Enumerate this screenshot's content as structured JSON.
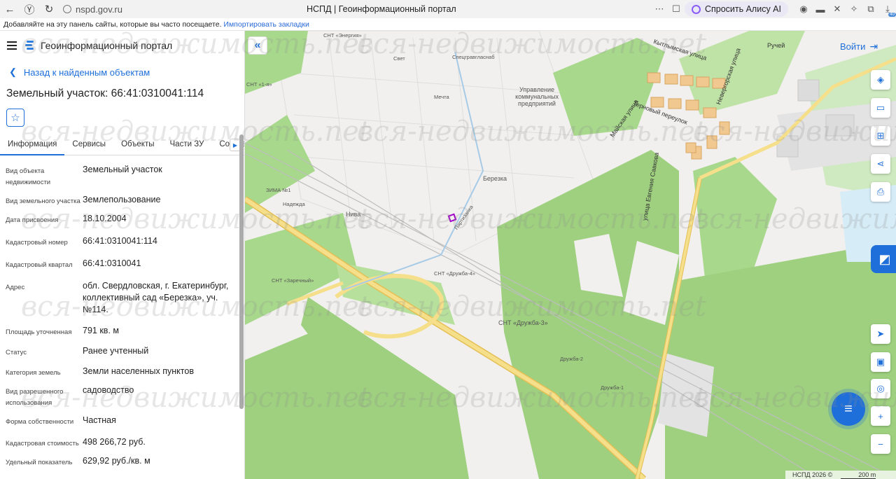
{
  "browser": {
    "url": "nspd.gov.ru",
    "tab_title": "НСПД | Геоинформационный портал",
    "alice_label": "Спросить Алису AI",
    "badge": "40",
    "bookmarks_text": "Добавляйте на эту панель сайты, которые вы часто посещаете.",
    "bookmarks_link": "Импортировать закладки"
  },
  "panel": {
    "portal_title": "Геоинформационный портал",
    "back_label": "Назад к найденным объектам",
    "object_title": "Земельный участок: 66:41:0310041:114",
    "tabs": [
      "Информация",
      "Сервисы",
      "Объекты",
      "Части ЗУ",
      "Состав"
    ],
    "properties": [
      {
        "key": "Вид объекта недвижимости",
        "value": "Земельный участок"
      },
      {
        "key": "Вид земельного участка",
        "value": "Землепользование"
      },
      {
        "key": "Дата присвоения",
        "value": "18.10.2004"
      },
      {
        "key": "Кадастровый номер",
        "value": "66:41:0310041:114"
      },
      {
        "key": "Кадастровый квартал",
        "value": "66:41:0310041"
      },
      {
        "key": "Адрес",
        "value": "обл. Свердловская, г. Екатеринбург, коллективный сад «Березка», уч. №114."
      },
      {
        "key": "Площадь уточненная",
        "value": "791 кв. м"
      },
      {
        "key": "Статус",
        "value": "Ранее учтенный"
      },
      {
        "key": "Категория земель",
        "value": "Земли населенных пунктов"
      },
      {
        "key": "Вид разрешенного использования",
        "value": "садоводство"
      },
      {
        "key": "Форма собственности",
        "value": "Частная"
      },
      {
        "key": "Кадастровая стоимость",
        "value": "498 266,72 руб."
      },
      {
        "key": "Удельный показатель",
        "value": "629,92 руб./кв. м"
      }
    ]
  },
  "map": {
    "login_label": "Войти",
    "labels": {
      "snt_energia": "СНТ «Энергия»",
      "svet": "Свет",
      "specgrav": "Спецгравгласнаб",
      "mechta": "Мечта",
      "upravlenie": "Управление коммунальных предприятий",
      "berezka": "Березка",
      "niva": "Нива",
      "nadezhda": "Надежда",
      "zima": "ЗИМА №1",
      "snt_zarechny": "СНТ «Заречный»",
      "snt_druzhba4": "СНТ «Дружба-4»",
      "snt_druzhba3": "СНТ «Дружба-3»",
      "druzhba2": "Дружба-2",
      "druzhba1": "Дружба-1",
      "savkova": "улица Евгения Савкова",
      "ternovy": "Терновый переулок",
      "maiskaya": "Майская улица",
      "kytlymskaya": "Кытлымская улица",
      "ruchei": "Ручей",
      "partizanka": "Партизанка",
      "snt1": "СНТ «1-я»",
      "nevergorskaya": "Невергорская улица"
    },
    "attribution": "НСПД 2026 ©",
    "scale": "200 m",
    "watermark": "вся-недвижимость.net"
  },
  "colors": {
    "accent": "#1e6fd9",
    "forest": "#9ed07f",
    "road": "#f3d36b",
    "garden": "#ececec"
  }
}
